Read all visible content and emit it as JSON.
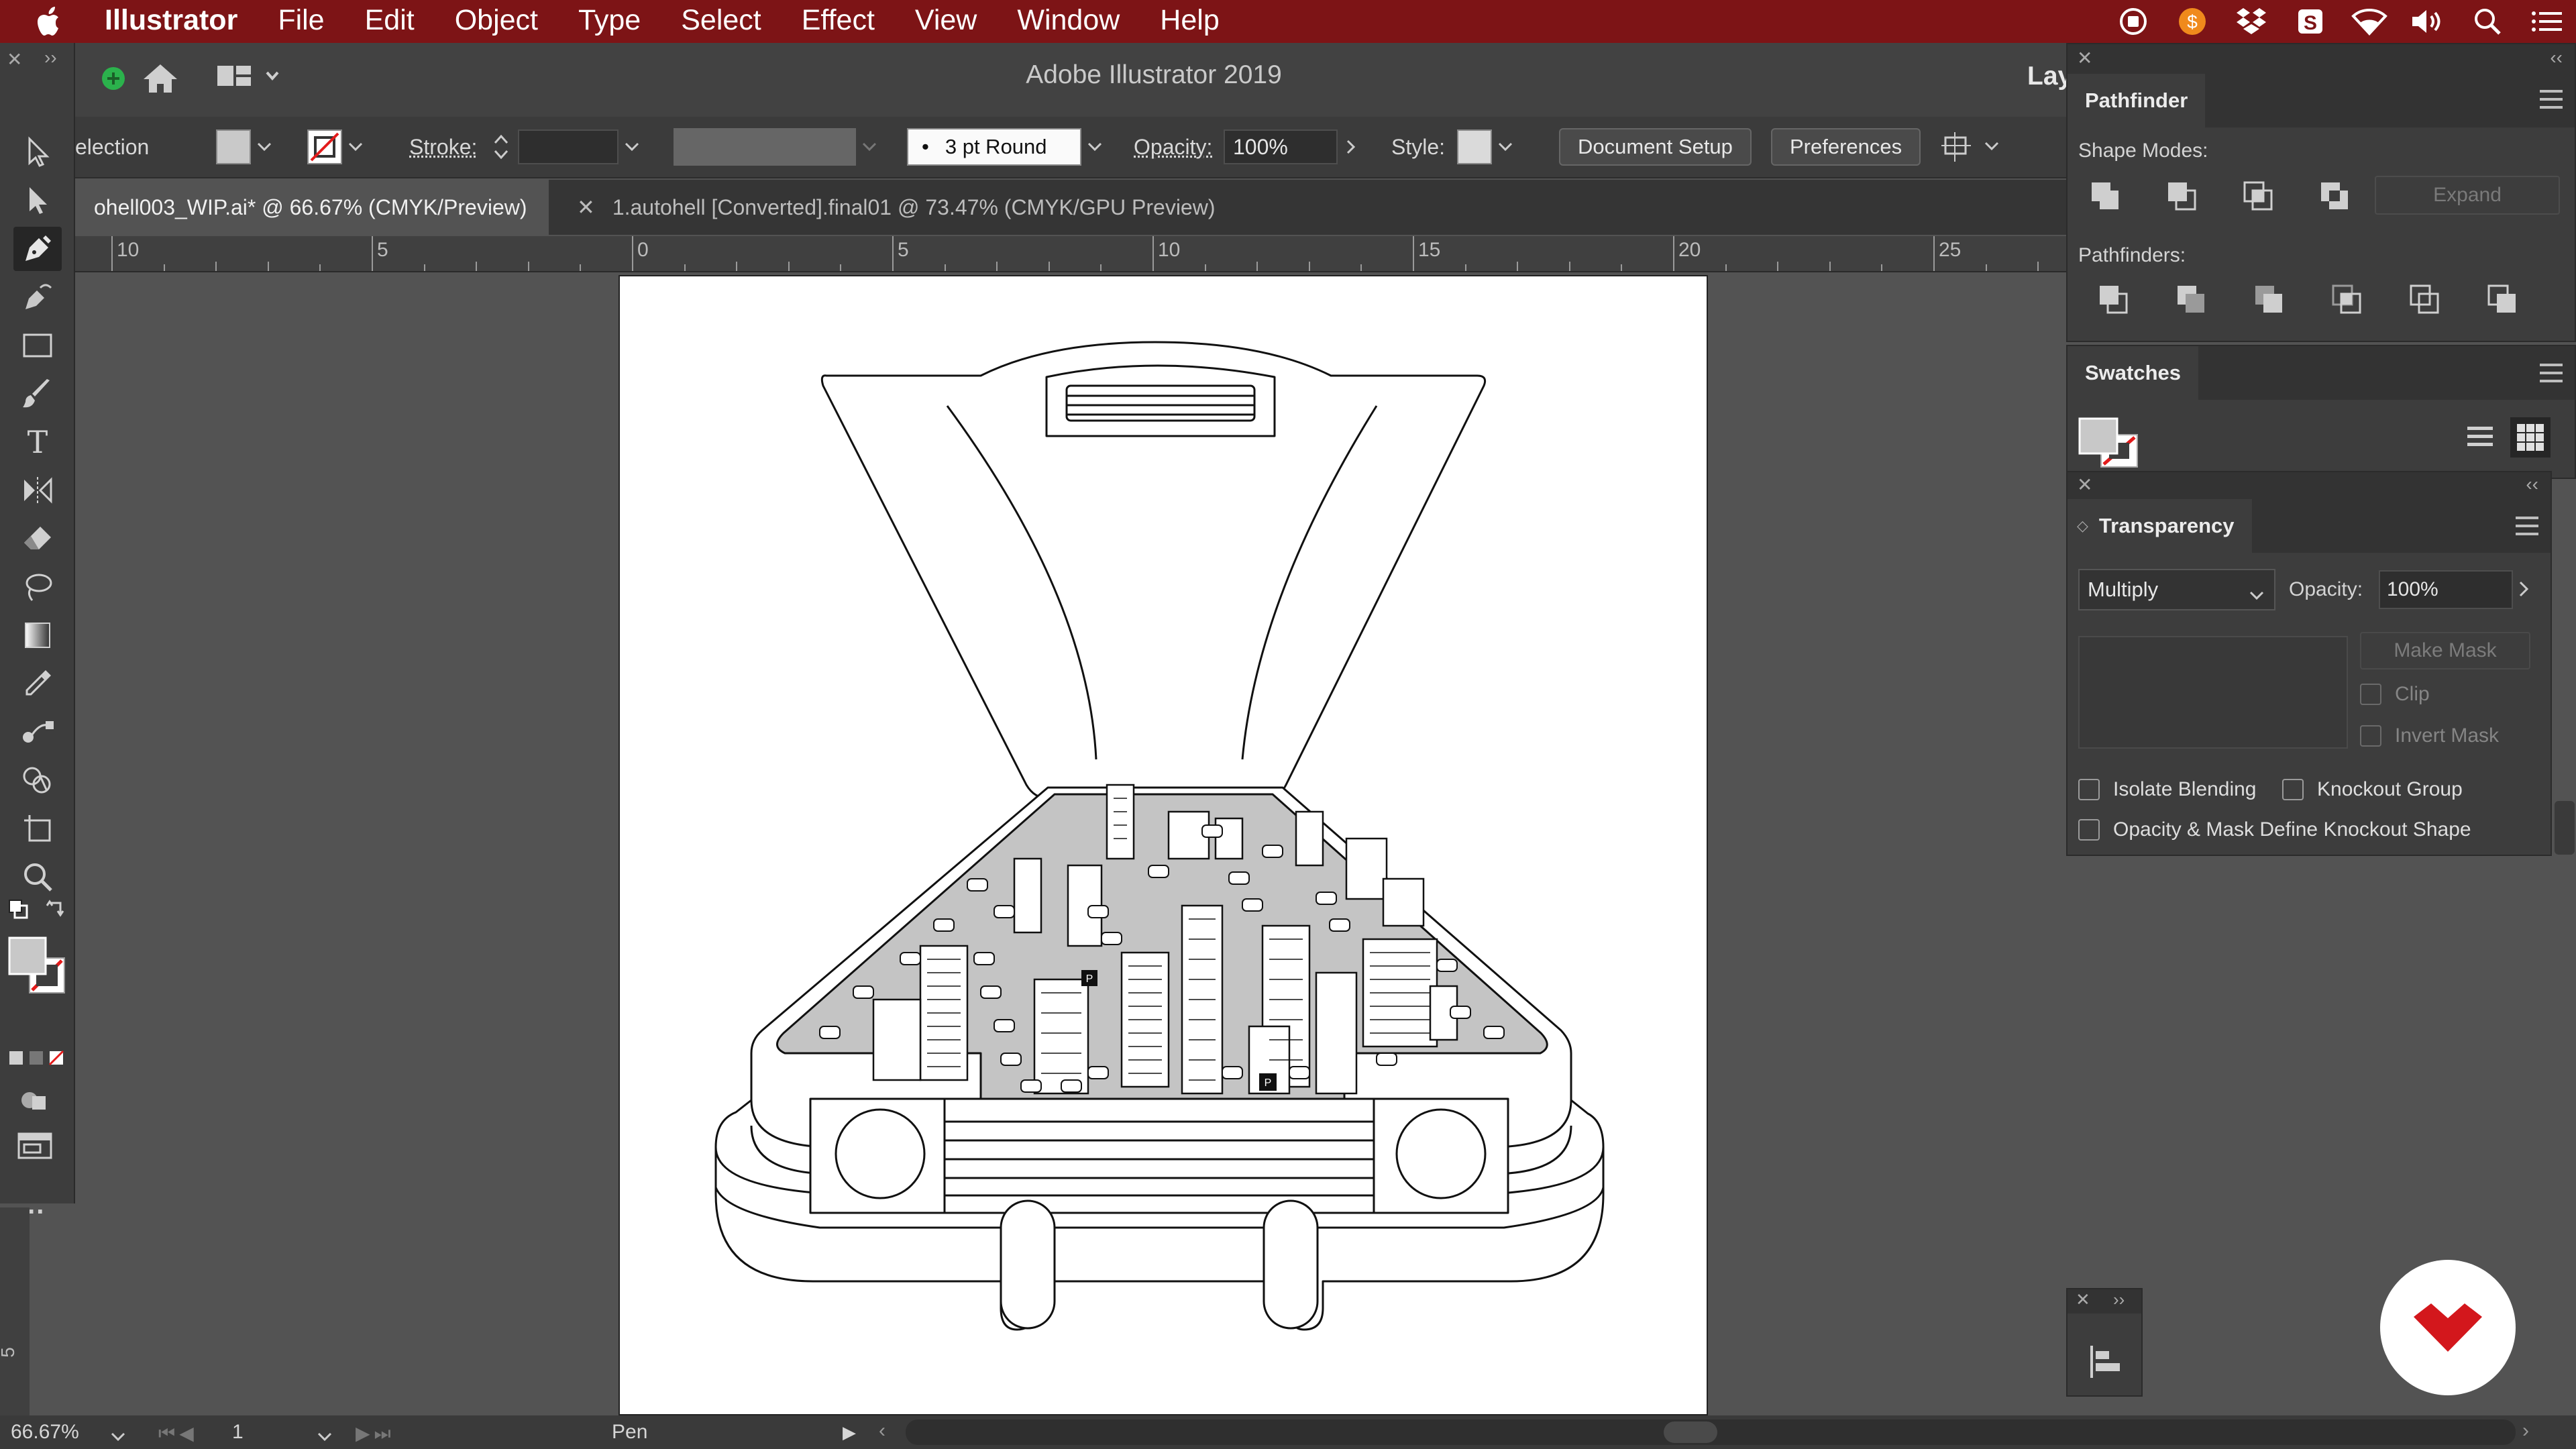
{
  "menubar": {
    "app_name": "Illustrator",
    "items": [
      "File",
      "Edit",
      "Object",
      "Type",
      "Select",
      "Effect",
      "View",
      "Window",
      "Help"
    ],
    "tray_icons": [
      "record-icon",
      "scrooge-icon",
      "dropbox-icon",
      "s-app-icon",
      "wifi-icon",
      "volume-icon",
      "spotlight-icon",
      "control-center-icon"
    ]
  },
  "titlebar": {
    "title": "Adobe Illustrator 2019",
    "workspace_label": "Lay"
  },
  "controlbar": {
    "selection_label": "election",
    "stroke_label": "Stroke:",
    "brush_value": "3 pt Round",
    "opacity_label": "Opacity:",
    "opacity_value": "100%",
    "style_label": "Style:",
    "document_setup": "Document Setup",
    "preferences": "Preferences"
  },
  "tabs": [
    {
      "label": "ohell003_WIP.ai* @ 66.67% (CMYK/Preview)",
      "active": true
    },
    {
      "label": "1.autohell [Converted].final01 @ 73.47% (CMYK/GPU Preview)",
      "active": false
    }
  ],
  "ruler": {
    "labels": [
      "10",
      "5",
      "0",
      "5",
      "10",
      "15",
      "20",
      "25"
    ]
  },
  "vertical_ruler_label": "5",
  "toolbar": {
    "tools": [
      "selection-tool-icon",
      "direct-selection-tool-icon",
      "pen-tool-icon",
      "curvature-tool-icon",
      "rectangle-tool-icon",
      "paintbrush-tool-icon",
      "type-tool-icon",
      "reflect-tool-icon",
      "eraser-tool-icon",
      "lasso-tool-icon",
      "gradient-tool-icon",
      "eyedropper-tool-icon",
      "blend-tool-icon",
      "shape-builder-tool-icon",
      "artboard-tool-icon",
      "zoom-tool-icon"
    ],
    "selected_tool": "pen-tool-icon",
    "more_label": "..."
  },
  "pathfinder": {
    "title": "Pathfinder",
    "shape_modes_label": "Shape Modes:",
    "pathfinders_label": "Pathfinders:",
    "expand_label": "Expand"
  },
  "swatches": {
    "title": "Swatches"
  },
  "transparency": {
    "title": "Transparency",
    "blend_mode": "Multiply",
    "opacity_label": "Opacity:",
    "opacity_value": "100%",
    "make_mask": "Make Mask",
    "clip": "Clip",
    "invert_mask": "Invert Mask",
    "isolate_blending": "Isolate Blending",
    "knockout_group": "Knockout Group",
    "opacity_mask_knockout": "Opacity & Mask Define Knockout Shape"
  },
  "status": {
    "zoom": "66.67%",
    "page": "1",
    "current_tool": "Pen"
  },
  "colors": {
    "menubar": "#7d1416",
    "accent_logo": "#d3171c",
    "panel_bg": "#3d3d3d",
    "canvas_bg": "#535353",
    "art_fill": "#c4c4c4"
  }
}
